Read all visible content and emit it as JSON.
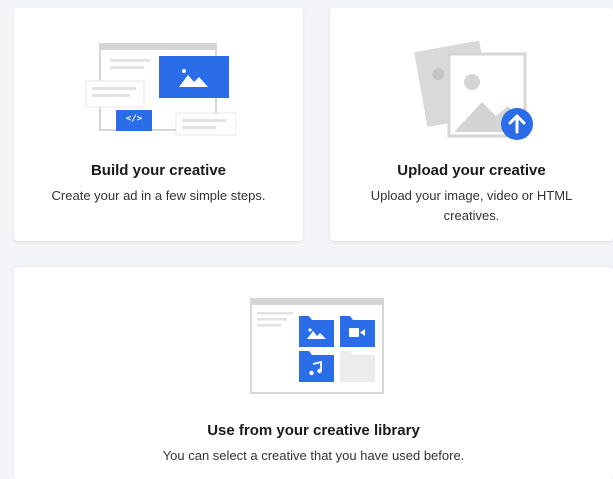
{
  "cards": [
    {
      "id": "build",
      "title": "Build your creative",
      "description": "Create your ad in a few simple steps.",
      "icon": "build-creative-illustration",
      "code_glyph": "</>"
    },
    {
      "id": "upload",
      "title": "Upload your creative",
      "description": "Upload your image, video or HTML creatives.",
      "icon": "upload-creative-illustration"
    },
    {
      "id": "library",
      "title": "Use from your creative library",
      "description": "You can select a creative that you have used before.",
      "icon": "creative-library-illustration"
    }
  ],
  "colors": {
    "accent": "#2b6de8",
    "card_bg": "#ffffff",
    "page_bg": "#f4f5f8",
    "illustration_gray": "#d9d9d9"
  }
}
